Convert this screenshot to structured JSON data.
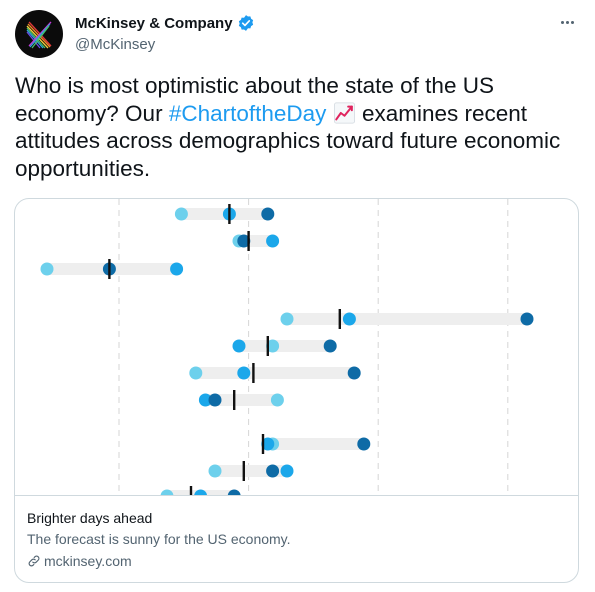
{
  "account": {
    "name": "McKinsey & Company",
    "handle": "@McKinsey"
  },
  "tweet": {
    "text_before": "Who is most optimistic about the state of the US economy? Our ",
    "hashtag": "#ChartoftheDay",
    "text_after": " examines recent attitudes across demographics toward future economic opportunities.",
    "emoji": "chart-increasing-emoji"
  },
  "card": {
    "title": "Brighter days ahead",
    "description": "The forecast is sunny for the US economy.",
    "link": "mckinsey.com"
  },
  "colors": {
    "light": "#6dd0ec",
    "mid": "#1ba7ea",
    "dark": "#0e6ba6",
    "bar": "#eeeeee",
    "grid": "#d6d6d6",
    "marker": "#111111",
    "link_blue": "#1d9bf0",
    "verified": "#1d9bf0"
  },
  "chart_data": {
    "type": "dot-range",
    "rows": [
      {
        "light": 0.33,
        "mid": 0.43,
        "dark": 0.51,
        "marker": 0.43
      },
      {
        "light": 0.45,
        "mid": 0.52,
        "dark": 0.46,
        "marker": 0.47
      },
      {
        "light": 0.05,
        "mid": 0.32,
        "dark": 0.18,
        "marker": 0.18
      },
      {
        "light": 0.55,
        "mid": 0.68,
        "dark": 1.05,
        "marker": 0.66
      },
      {
        "light": 0.52,
        "mid": 0.45,
        "dark": 0.64,
        "marker": 0.51
      },
      {
        "light": 0.36,
        "mid": 0.46,
        "dark": 0.69,
        "marker": 0.48
      },
      {
        "light": 0.53,
        "mid": 0.38,
        "dark": 0.4,
        "marker": 0.44
      },
      {
        "light": 0.52,
        "mid": 0.51,
        "dark": 0.71,
        "marker": 0.5
      },
      {
        "light": 0.4,
        "mid": 0.55,
        "dark": 0.52,
        "marker": 0.46
      },
      {
        "light": 0.3,
        "mid": 0.37,
        "dark": 0.44,
        "marker": 0.35
      }
    ]
  }
}
